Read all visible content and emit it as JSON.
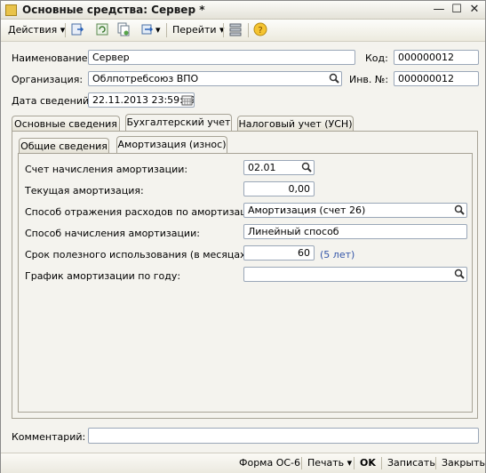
{
  "window": {
    "title": "Основные средства: Сервер *"
  },
  "toolbar": {
    "actions_label": "Действия",
    "goto_label": "Перейти"
  },
  "header": {
    "name_label": "Наименование:",
    "name_value": "Сервер",
    "code_label": "Код:",
    "code_value": "000000012",
    "org_label": "Организация:",
    "org_value": "Облпотребсоюз ВПО",
    "inv_label": "Инв. №:",
    "inv_value": "000000012",
    "date_label": "Дата сведений:",
    "date_value": "22.11.2013 23:59:59"
  },
  "tabs": [
    "Основные сведения",
    "Бухгалтерский учет",
    "Налоговый учет (УСН)"
  ],
  "subtabs": [
    "Общие сведения",
    "Амортизация (износ)"
  ],
  "amort": {
    "account_label": "Счет начисления амортизации:",
    "account_value": "02.01",
    "current_label": "Текущая амортизация:",
    "current_value": "0,00",
    "expense_label": "Способ отражения расходов по амортизации:",
    "expense_value": "Амортизация (счет 26)",
    "method_label": "Способ начисления амортизации:",
    "method_value": "Линейный способ",
    "term_label": "Срок полезного использования (в месяцах):",
    "term_value": "60",
    "term_hint": "(5 лет)",
    "schedule_label": "График амортизации по году:",
    "schedule_value": ""
  },
  "comment": {
    "label": "Комментарий:",
    "value": ""
  },
  "bottom": {
    "form_label": "Форма ОС-6",
    "print_label": "Печать",
    "ok_label": "OK",
    "save_label": "Записать",
    "close_label": "Закрыть"
  }
}
